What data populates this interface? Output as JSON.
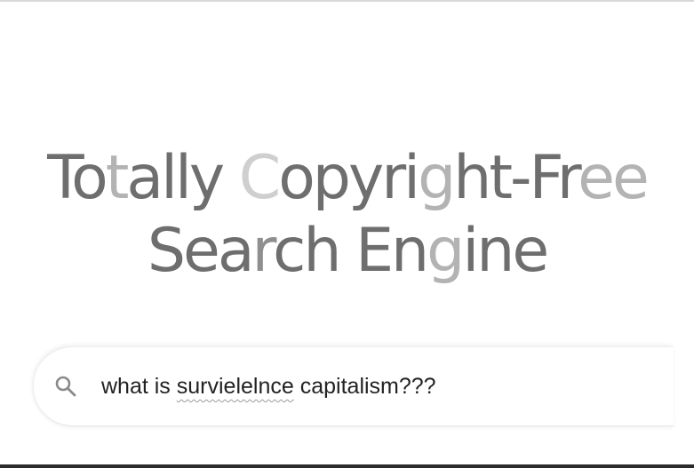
{
  "logo": {
    "line1": [
      {
        "text": "To",
        "tone": "c0"
      },
      {
        "text": "t",
        "tone": "c1"
      },
      {
        "text": "ally ",
        "tone": "c0"
      },
      {
        "text": "C",
        "tone": "c3"
      },
      {
        "text": "opyri",
        "tone": "c0"
      },
      {
        "text": "g",
        "tone": "c1"
      },
      {
        "text": "ht-Fr",
        "tone": "c0"
      },
      {
        "text": "ee",
        "tone": "c1"
      }
    ],
    "line2": [
      {
        "text": "Sea",
        "tone": "c0"
      },
      {
        "text": "r",
        "tone": "c2"
      },
      {
        "text": "ch En",
        "tone": "c0"
      },
      {
        "text": "g",
        "tone": "c1"
      },
      {
        "text": "ine",
        "tone": "c0"
      }
    ]
  },
  "search": {
    "icon": "search-icon",
    "query_before": "what is ",
    "query_misspelled": "survielelnce",
    "query_after": " capitalism???"
  },
  "colors": {
    "logo_dark": "#6e6e6e",
    "logo_mid": "#8f8f8f",
    "logo_light": "#b3b3b3",
    "logo_lightest": "#cfcfcf",
    "query_text": "#222222"
  }
}
